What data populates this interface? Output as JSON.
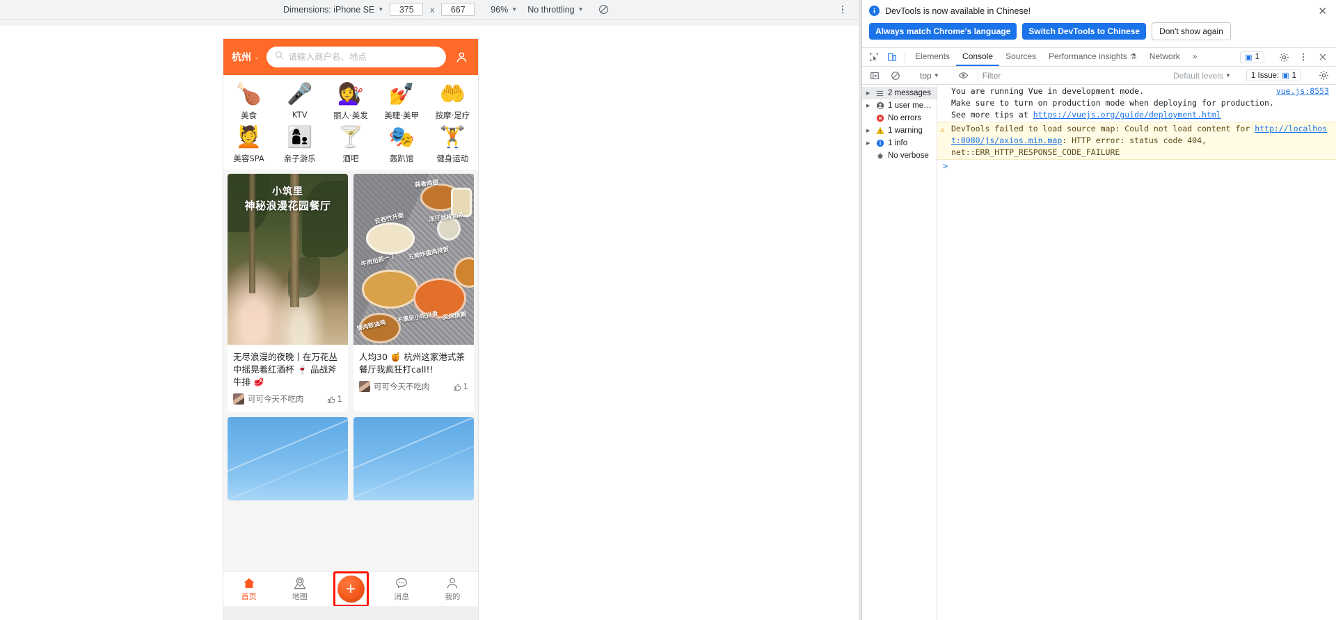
{
  "device_toolbar": {
    "dimensions_label": "Dimensions: iPhone SE",
    "width_value": "375",
    "x_separator": "x",
    "height_value": "667",
    "zoom_value": "96%",
    "throttling_value": "No throttling"
  },
  "phone_app": {
    "header": {
      "city": "杭州",
      "search_placeholder": "请输入商户名、地点",
      "search_value": ""
    },
    "categories": [
      {
        "label": "美食",
        "emoji": "🍗",
        "icon": "roast-chicken-icon"
      },
      {
        "label": "KTV",
        "emoji": "🎤",
        "icon": "microphone-icon"
      },
      {
        "label": "丽人·美发",
        "emoji": "💇‍♀️",
        "icon": "hair-styling-icon"
      },
      {
        "label": "美睫·美甲",
        "emoji": "💅",
        "icon": "nail-polish-icon"
      },
      {
        "label": "按摩·足疗",
        "emoji": "🤲",
        "icon": "massage-hands-icon"
      },
      {
        "label": "美容SPA",
        "emoji": "💆",
        "icon": "spa-mask-icon"
      },
      {
        "label": "亲子游乐",
        "emoji": "👩‍👦",
        "icon": "parent-child-icon"
      },
      {
        "label": "酒吧",
        "emoji": "🍸",
        "icon": "cocktail-icon"
      },
      {
        "label": "轰趴馆",
        "emoji": "🎭",
        "icon": "party-mask-icon"
      },
      {
        "label": "健身运动",
        "emoji": "🏋",
        "icon": "dumbbell-icon"
      }
    ],
    "feed": [
      {
        "image_kind": "garden",
        "image_title_line1": "小筑里",
        "image_title_line2": "神秘浪漫花园餐厅",
        "title": "无尽浪漫的夜晚丨在万花丛中摇晃着红酒杯 🍷 品战斧牛排 🥩",
        "author": "可可今天不吃肉",
        "likes": "1"
      },
      {
        "image_kind": "food",
        "image_tags": [
          "蒜香鸡翅",
          "云吞竹升面",
          "冻仔丝袜奶茶",
          "牛肉出前一丁",
          "五柳炸蛋鸡排饭",
          "烧肉豉油鸡",
          "不满足小吃拼盘",
          "叉烧烧鹅"
        ],
        "title": "人均30 🍯 杭州这家港式茶餐厅我疯狂打call!!",
        "author": "可可今天不吃肉",
        "likes": "1"
      },
      {
        "image_kind": "sky",
        "title": "",
        "author": "",
        "likes": ""
      },
      {
        "image_kind": "sky",
        "title": "",
        "author": "",
        "likes": ""
      }
    ],
    "tabbar": [
      {
        "label": "首页",
        "icon": "home-icon",
        "active": true
      },
      {
        "label": "地图",
        "icon": "map-pin-icon",
        "active": false
      },
      {
        "label": "消息",
        "icon": "chat-bubble-icon",
        "active": false
      },
      {
        "label": "我的",
        "icon": "person-icon",
        "active": false
      }
    ],
    "add_button_label": "+"
  },
  "devtools": {
    "locale_banner": {
      "message": "DevTools is now available in Chinese!",
      "btn_always_match": "Always match Chrome's language",
      "btn_switch": "Switch DevTools to Chinese",
      "btn_dont_show": "Don't show again"
    },
    "tabs": [
      {
        "label": "Elements",
        "active": false
      },
      {
        "label": "Console",
        "active": true
      },
      {
        "label": "Sources",
        "active": false
      },
      {
        "label": "Performance insights",
        "active": false,
        "flask": true
      },
      {
        "label": "Network",
        "active": false
      }
    ],
    "tabs_overflow": "»",
    "tab_issue_count": "1",
    "console_toolbar": {
      "context_value": "top",
      "filter_placeholder": "Filter",
      "filter_value": "",
      "levels_value": "Default levels",
      "issues_label": "1 Issue:",
      "issues_count": "1"
    },
    "sidebar": [
      {
        "label": "2 messages",
        "icon": "list-icon",
        "selected": true,
        "expandable": true
      },
      {
        "label": "1 user mess…",
        "icon": "user-icon",
        "selected": false,
        "expandable": true
      },
      {
        "label": "No errors",
        "icon": "error-icon",
        "selected": false,
        "expandable": false
      },
      {
        "label": "1 warning",
        "icon": "warning-icon",
        "selected": false,
        "expandable": true
      },
      {
        "label": "1 info",
        "icon": "info-icon",
        "selected": false,
        "expandable": true
      },
      {
        "label": "No verbose",
        "icon": "bug-icon",
        "selected": false,
        "expandable": false
      }
    ],
    "messages": {
      "vue": {
        "line1": "You are running Vue in development mode.",
        "line2": "Make sure to turn on production mode when deploying for production.",
        "line3_prefix": "See more tips at ",
        "line3_link": "https://vuejs.org/guide/deployment.html",
        "source": "vue.js:8553"
      },
      "warning": {
        "prefix": "DevTools failed to load source map: Could not load content for ",
        "link1": "http://localhost:8080/js/axios.min.map",
        "mid": ": HTTP error: status code 404,",
        "tail": "net::ERR_HTTP_RESPONSE_CODE_FAILURE"
      },
      "prompt_caret": ">"
    }
  },
  "colors": {
    "app_orange": "#ff6a28",
    "accent_blue": "#1a73e8",
    "highlight_red": "#ff1500",
    "warn_bg": "#fffbe5"
  }
}
